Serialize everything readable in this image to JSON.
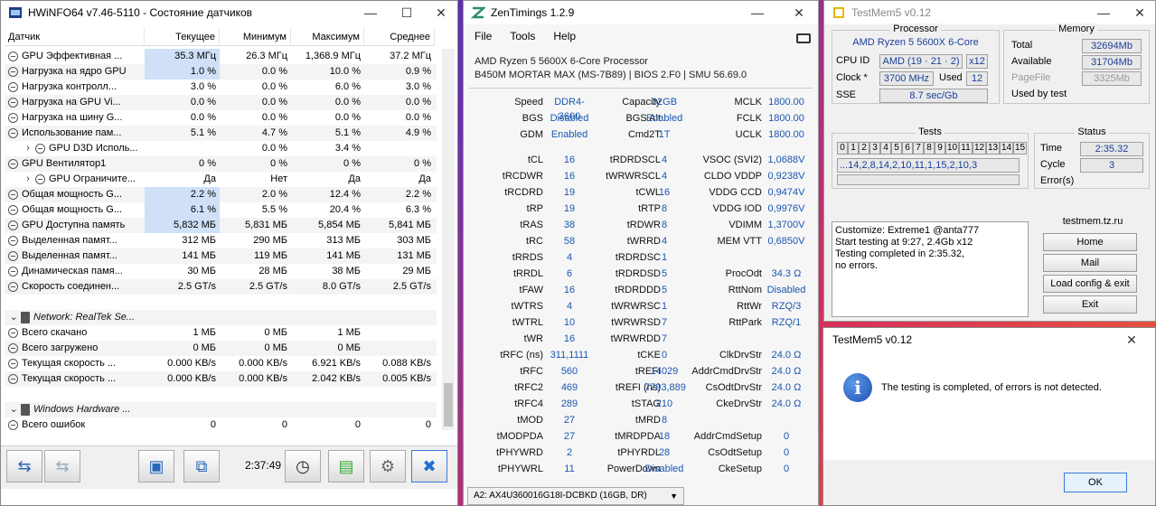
{
  "hwinfo": {
    "title": "HWiNFO64 v7.46-5110 - Состояние датчиков",
    "columns": [
      "Датчик",
      "Текущее",
      "Минимум",
      "Максимум",
      "Среднее"
    ],
    "rows": [
      {
        "type": "sensor",
        "name": "GPU Эффективная ...",
        "cur": "35.3 МГц",
        "min": "26.3 МГц",
        "max": "1,368.9 МГц",
        "avg": "37.2 МГц",
        "hl": true
      },
      {
        "type": "sensor",
        "name": "Нагрузка на ядро GPU",
        "cur": "1.0 %",
        "min": "0.0 %",
        "max": "10.0 %",
        "avg": "0.9 %",
        "hl": true
      },
      {
        "type": "sensor",
        "name": "Нагрузка контролл...",
        "cur": "3.0 %",
        "min": "0.0 %",
        "max": "6.0 %",
        "avg": "3.0 %"
      },
      {
        "type": "sensor",
        "name": "Нагрузка на GPU Vi...",
        "cur": "0.0 %",
        "min": "0.0 %",
        "max": "0.0 %",
        "avg": "0.0 %"
      },
      {
        "type": "sensor",
        "name": "Нагрузка на шину G...",
        "cur": "0.0 %",
        "min": "0.0 %",
        "max": "0.0 %",
        "avg": "0.0 %"
      },
      {
        "type": "sensor",
        "name": "Использование пам...",
        "cur": "5.1 %",
        "min": "4.7 %",
        "max": "5.1 %",
        "avg": "4.9 %"
      },
      {
        "type": "subgroup",
        "name": "GPU D3D Исполь...",
        "cur": "",
        "min": "0.0 %",
        "max": "3.4 %",
        "avg": ""
      },
      {
        "type": "sensor",
        "name": "GPU Вентилятор1",
        "cur": "0 %",
        "min": "0 %",
        "max": "0 %",
        "avg": "0 %"
      },
      {
        "type": "subgroup",
        "name": "GPU Ограничите...",
        "cur": "Да",
        "min": "Нет",
        "max": "Да",
        "avg": "Да"
      },
      {
        "type": "sensor",
        "name": "Общая мощность G...",
        "cur": "2.2 %",
        "min": "2.0 %",
        "max": "12.4 %",
        "avg": "2.2 %",
        "hl": true
      },
      {
        "type": "sensor",
        "name": "Общая мощность G...",
        "cur": "6.1 %",
        "min": "5.5 %",
        "max": "20.4 %",
        "avg": "6.3 %",
        "hl": true
      },
      {
        "type": "sensor",
        "name": "GPU Доступна память",
        "cur": "5,832 МБ",
        "min": "5,831 МБ",
        "max": "5,854 МБ",
        "avg": "5,841 МБ",
        "hl": true
      },
      {
        "type": "sensor",
        "name": "Выделенная памят...",
        "cur": "312 МБ",
        "min": "290 МБ",
        "max": "313 МБ",
        "avg": "303 МБ"
      },
      {
        "type": "sensor",
        "name": "Выделенная памят...",
        "cur": "141 МБ",
        "min": "119 МБ",
        "max": "141 МБ",
        "avg": "131 МБ"
      },
      {
        "type": "sensor",
        "name": "Динамическая памя...",
        "cur": "30 МБ",
        "min": "28 МБ",
        "max": "38 МБ",
        "avg": "29 МБ"
      },
      {
        "type": "sensor",
        "name": "Скорость соединен...",
        "cur": "2.5 GT/s",
        "min": "2.5 GT/s",
        "max": "8.0 GT/s",
        "avg": "2.5 GT/s"
      },
      {
        "type": "blank"
      },
      {
        "type": "group",
        "name": "Network: RealTek Se..."
      },
      {
        "type": "sensor",
        "name": "Всего скачано",
        "cur": "1 МБ",
        "min": "0 МБ",
        "max": "1 МБ",
        "avg": ""
      },
      {
        "type": "sensor",
        "name": "Всего загружено",
        "cur": "0 МБ",
        "min": "0 МБ",
        "max": "0 МБ",
        "avg": ""
      },
      {
        "type": "sensor",
        "name": "Текущая скорость ...",
        "cur": "0.000 KB/s",
        "min": "0.000 KB/s",
        "max": "6.921 KB/s",
        "avg": "0.088 KB/s"
      },
      {
        "type": "sensor",
        "name": "Текущая скорость ...",
        "cur": "0.000 KB/s",
        "min": "0.000 KB/s",
        "max": "2.042 KB/s",
        "avg": "0.005 KB/s"
      },
      {
        "type": "blank"
      },
      {
        "type": "group",
        "name": "Windows Hardware ..."
      },
      {
        "type": "sensor",
        "name": "Всего ошибок",
        "cur": "0",
        "min": "0",
        "max": "0",
        "avg": "0"
      }
    ],
    "timer": "2:37:49"
  },
  "zentimings": {
    "title": "ZenTimings 1.2.9",
    "menu": [
      "File",
      "Tools",
      "Help"
    ],
    "cpu": "AMD Ryzen 5 5600X 6-Core Processor",
    "board": "B450M MORTAR MAX (MS-7B89) | BIOS 2.F0 | SMU 56.69.0",
    "top": [
      [
        "Speed",
        "DDR4-3600",
        "Capacity",
        "32GB",
        "MCLK",
        "1800.00"
      ],
      [
        "BGS",
        "Disabled",
        "BGS Alt",
        "Enabled",
        "FCLK",
        "1800.00"
      ],
      [
        "GDM",
        "Enabled",
        "Cmd2T",
        "1T",
        "UCLK",
        "1800.00"
      ]
    ],
    "timings": [
      [
        "tCL",
        "16",
        "tRDRDSCL",
        "4",
        "VSOC (SVI2)",
        "1,0688V"
      ],
      [
        "tRCDWR",
        "16",
        "tWRWRSCL",
        "4",
        "CLDO VDDP",
        "0,9238V"
      ],
      [
        "tRCDRD",
        "19",
        "tCWL",
        "16",
        "VDDG CCD",
        "0,9474V"
      ],
      [
        "tRP",
        "19",
        "tRTP",
        "8",
        "VDDG IOD",
        "0,9976V"
      ],
      [
        "tRAS",
        "38",
        "tRDWR",
        "8",
        "VDIMM",
        "1,3700V"
      ],
      [
        "tRC",
        "58",
        "tWRRD",
        "4",
        "MEM VTT",
        "0,6850V"
      ],
      [
        "tRRDS",
        "4",
        "tRDRDSC",
        "1",
        "",
        ""
      ],
      [
        "tRRDL",
        "6",
        "tRDRDSD",
        "5",
        "ProcOdt",
        "34.3 Ω"
      ],
      [
        "tFAW",
        "16",
        "tRDRDDD",
        "5",
        "RttNom",
        "Disabled"
      ],
      [
        "tWTRS",
        "4",
        "tWRWRSC",
        "1",
        "RttWr",
        "RZQ/3"
      ],
      [
        "tWTRL",
        "10",
        "tWRWRSD",
        "7",
        "RttPark",
        "RZQ/1"
      ],
      [
        "tWR",
        "16",
        "tWRWRDD",
        "7",
        "",
        ""
      ],
      [
        "tRFC (ns)",
        "311,1111",
        "tCKE",
        "0",
        "ClkDrvStr",
        "24.0 Ω"
      ],
      [
        "tRFC",
        "560",
        "tREFI",
        "14029",
        "AddrCmdDrvStr",
        "24.0 Ω"
      ],
      [
        "tRFC2",
        "469",
        "tREFI (ns)",
        "7793,889",
        "CsOdtDrvStr",
        "24.0 Ω"
      ],
      [
        "tRFC4",
        "289",
        "tSTAG",
        "210",
        "CkeDrvStr",
        "24.0 Ω"
      ],
      [
        "tMOD",
        "27",
        "tMRD",
        "8",
        "",
        ""
      ],
      [
        "tMODPDA",
        "27",
        "tMRDPDA",
        "18",
        "AddrCmdSetup",
        "0"
      ],
      [
        "tPHYWRD",
        "2",
        "tPHYRDL",
        "28",
        "CsOdtSetup",
        "0"
      ],
      [
        "tPHYWRL",
        "11",
        "PowerDown",
        "Disabled",
        "CkeSetup",
        "0"
      ]
    ],
    "module": "A2: AX4U360016G18I-DCBKD (16GB, DR)"
  },
  "testmem": {
    "title": "TestMem5 v0.12",
    "processor_legend": "Processor",
    "cpu_name": "AMD Ryzen 5 5600X 6-Core",
    "cpu_id_label": "CPU ID",
    "cpu_id": "AMD (19 · 21 · 2)",
    "threads": "x12",
    "clock_label": "Clock *",
    "clock": "3700 MHz",
    "used_label": "Used",
    "used": "12",
    "sse_label": "SSE",
    "sse": "8.7 sec/Gb",
    "memory_legend": "Memory",
    "total_label": "Total",
    "total": "32694Mb",
    "available_label": "Available",
    "available": "31704Mb",
    "pagefile_label": "PageFile",
    "pagefile": "3325Mb",
    "usedby_label": "Used by test",
    "tests_legend": "Tests",
    "test_cells": [
      "0",
      "1",
      "2",
      "3",
      "4",
      "5",
      "6",
      "7",
      "8",
      "9",
      "10",
      "11",
      "12",
      "13",
      "14",
      "15"
    ],
    "sequence": "...14,2,8,14,2,10,11,1,15,2,10,3",
    "status_legend": "Status",
    "time_label": "Time",
    "time": "2:35.32",
    "cycle_label": "Cycle",
    "cycle": "3",
    "errors_label": "Error(s)",
    "log": [
      "Customize: Extreme1 @anta777",
      "Start testing at 9:27, 2.4Gb x12",
      "Testing completed in 2:35.32,",
      "no errors."
    ],
    "site_legend": "testmem.tz.ru",
    "buttons": [
      "Home",
      "Mail",
      "Load config & exit",
      "Exit"
    ]
  },
  "dialog": {
    "title": "TestMem5 v0.12",
    "message": "The testing is completed, of errors is not detected.",
    "ok": "OK"
  }
}
